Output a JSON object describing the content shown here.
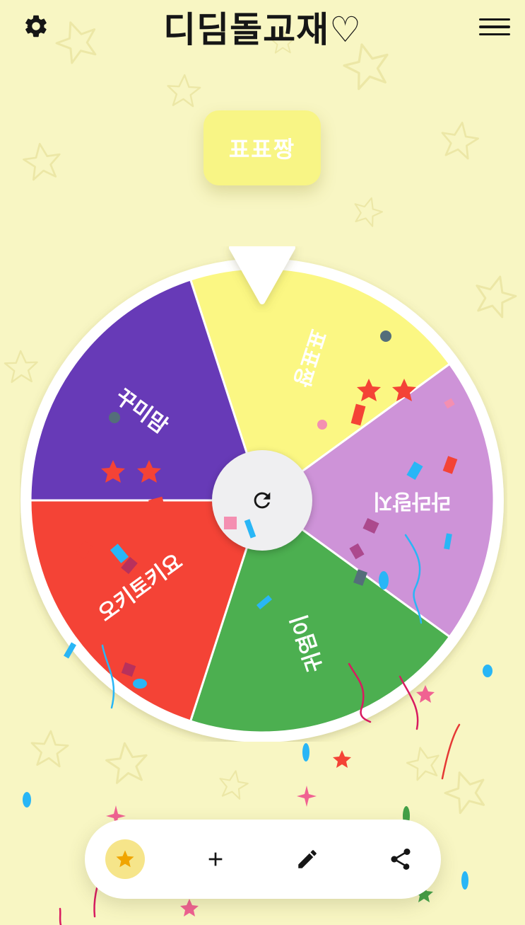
{
  "app": {
    "title": "디딤돌교재♡"
  },
  "header": {
    "settings_icon": "gear-icon",
    "menu_icon": "hamburger-menu-icon"
  },
  "result": {
    "label": "표표짱"
  },
  "wheel": {
    "segments": [
      {
        "label": "표표짱",
        "color": "#fbf783"
      },
      {
        "label": "라라랑지",
        "color": "#ce93d8"
      },
      {
        "label": "귀염이",
        "color": "#4caf50"
      },
      {
        "label": "오키토키요",
        "color": "#f44336"
      },
      {
        "label": "꾸미맘",
        "color": "#673ab7"
      }
    ],
    "spin_icon": "refresh-icon"
  },
  "toolbar": {
    "items": [
      {
        "icon": "star-icon",
        "active": true
      },
      {
        "icon": "plus-icon"
      },
      {
        "icon": "pencil-icon"
      },
      {
        "icon": "share-icon"
      }
    ]
  },
  "colors": {
    "background": "#f8f6c3",
    "result_box": "#f8f585",
    "toolbar_active": "#f6e58a",
    "star_accent": "#f0a500"
  }
}
